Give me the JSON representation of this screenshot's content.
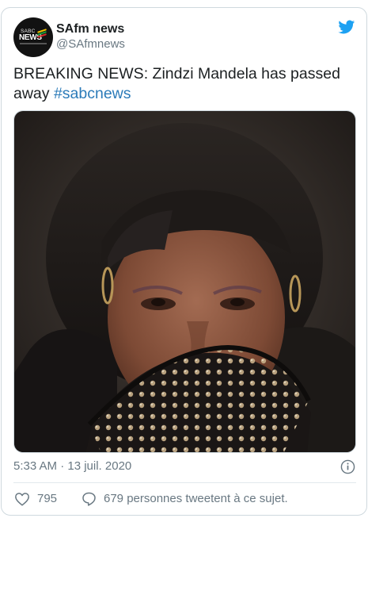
{
  "author": {
    "display_name": "SAfm news",
    "handle": "@SAfmnews",
    "avatar_sabc": "SABC",
    "avatar_news": "NEWS"
  },
  "tweet": {
    "text": "BREAKING NEWS: Zindzi Mandela has passed away ",
    "hashtag": "#sabcnews",
    "timestamp": "5:33 AM · 13 juil. 2020"
  },
  "actions": {
    "like_count": "795",
    "reply_text": "679 personnes tweetent à ce sujet."
  },
  "icons": {
    "brand": "twitter-bird-icon",
    "info": "info-icon",
    "like": "heart-icon",
    "reply": "speech-bubble-icon"
  },
  "colors": {
    "link": "#2b7bb9",
    "twitter_blue": "#1da1f2",
    "muted_text": "#697882",
    "border": "#cfd9de"
  }
}
